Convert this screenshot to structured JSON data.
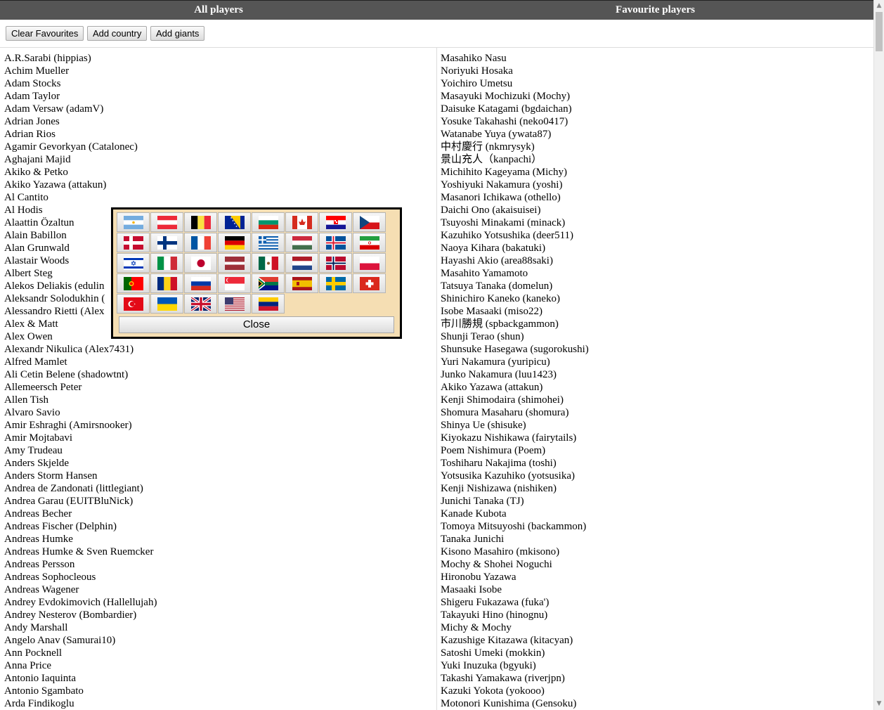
{
  "header": {
    "all_title": "All players",
    "fav_title": "Favourite players"
  },
  "toolbar": {
    "clear_label": "Clear Favourites",
    "add_country_label": "Add country",
    "add_giants_label": "Add giants"
  },
  "all_players": [
    "A.R.Sarabi (hippias)",
    "Achim Mueller",
    "Adam Stocks",
    "Adam Taylor",
    "Adam Versaw (adamV)",
    "Adrian Jones",
    "Adrian Rios",
    "Agamir Gevorkyan (Catalonec)",
    "Aghajani Majid",
    "Akiko & Petko",
    "Akiko Yazawa (attakun)",
    "Al Cantito",
    "Al Hodis",
    "Alaattin Özaltun",
    "Alain Babillon",
    "Alan Grunwald",
    "Alastair Woods",
    "Albert Steg",
    "Alekos Deliakis (edulin",
    "Aleksandr Solodukhin (",
    "Alessandro Rietti (Alex",
    "Alex & Matt",
    "Alex Owen",
    "Alexandr Nikulica (Alex7431)",
    "Alfred Mamlet",
    "Ali Cetin Belene (shadowtnt)",
    "Allemeersch Peter",
    "Allen Tish",
    "Alvaro Savio",
    "Amir Eshraghi (Amirsnooker)",
    "Amir Mojtabavi",
    "Amy Trudeau",
    "Anders Skjelde",
    "Anders Storm Hansen",
    "Andrea de Zandonati (littlegiant)",
    "Andrea Garau (EUITBluNick)",
    "Andreas Becher",
    "Andreas Fischer (Delphin)",
    "Andreas Humke",
    "Andreas Humke & Sven Ruemcker",
    "Andreas Persson",
    "Andreas Sophocleous",
    "Andreas Wagener",
    "Andrey Evdokimovich (Hallellujah)",
    "Andrey Nesterov (Bombardier)",
    "Andy Marshall",
    "Angelo Anav (Samurai10)",
    "Ann Pocknell",
    "Anna Price",
    "Antonio Iaquinta",
    "Antonio Sgambato",
    "Arda Findikoglu"
  ],
  "favourite_players": [
    "Masahiko Nasu",
    "Noriyuki Hosaka",
    "Yoichiro Umetsu",
    "Masayuki Mochizuki (Mochy)",
    "Daisuke Katagami (bgdaichan)",
    "Yosuke Takahashi (neko0417)",
    "Watanabe Yuya (ywata87)",
    "中村慶行 (nkmrysyk)",
    "景山充人（kanpachi）",
    "Michihito Kageyama (Michy)",
    "Yoshiyuki Nakamura (yoshi)",
    "Masanori Ichikawa (othello)",
    "Daichi Ono (akaisuisei)",
    "Tsuyoshi Minakami (minack)",
    "Kazuhiko Yotsushika (deer511)",
    "Naoya Kihara (bakatuki)",
    "Hayashi Akio (area88saki)",
    "Masahito Yamamoto",
    "Tatsuya Tanaka (domelun)",
    "Shinichiro Kaneko (kaneko)",
    "Isobe Masaaki (miso22)",
    "市川勝規 (spbackgammon)",
    "Shunji Terao (shun)",
    "Shunsuke Hasegawa (sugorokushi)",
    "Yuri Nakamura (yuripicu)",
    "Junko Nakamura (luu1423)",
    "Akiko Yazawa (attakun)",
    "Kenji Shimodaira (shimohei)",
    "Shomura Masaharu (shomura)",
    "Shinya Ue (shisuke)",
    "Kiyokazu Nishikawa (fairytails)",
    "Poem Nishimura (Poem)",
    "Toshiharu Nakajima (toshi)",
    "Yotsusika Kazuhiko (yotsusika)",
    "Kenji Nishizawa (nishiken)",
    "Junichi Tanaka (TJ)",
    "Kanade Kubota",
    "Tomoya Mitsuyoshi (backammon)",
    "Tanaka Junichi",
    "Kisono Masahiro (mkisono)",
    "Mochy & Shohei Noguchi",
    "Hironobu Yazawa",
    "Masaaki Isobe",
    "Shigeru Fukazawa (fuka')",
    "Takayuki Hino (hinognu)",
    "Michy & Mochy",
    "Kazushige Kitazawa (kitacyan)",
    "Satoshi Umeki (mokkin)",
    "Yuki Inuzuka (bgyuki)",
    "Takashi Yamakawa (riverjpn)",
    "Kazuki Yokota (yokooo)",
    "Motonori Kunishima (Gensoku)"
  ],
  "country_popup": {
    "flags": [
      "argentina",
      "austria",
      "belgium",
      "bosnia",
      "bulgaria",
      "canada",
      "croatia",
      "czech-republic",
      "denmark",
      "finland",
      "france",
      "germany",
      "greece",
      "hungary",
      "iceland",
      "iran",
      "israel",
      "italy",
      "japan",
      "latvia",
      "mexico",
      "netherlands",
      "norway",
      "poland",
      "portugal",
      "romania",
      "russia",
      "singapore",
      "south-africa",
      "spain",
      "sweden",
      "switzerland",
      "turkey",
      "ukraine",
      "united-kingdom",
      "united-states",
      "venezuela"
    ],
    "close_label": "Close"
  }
}
